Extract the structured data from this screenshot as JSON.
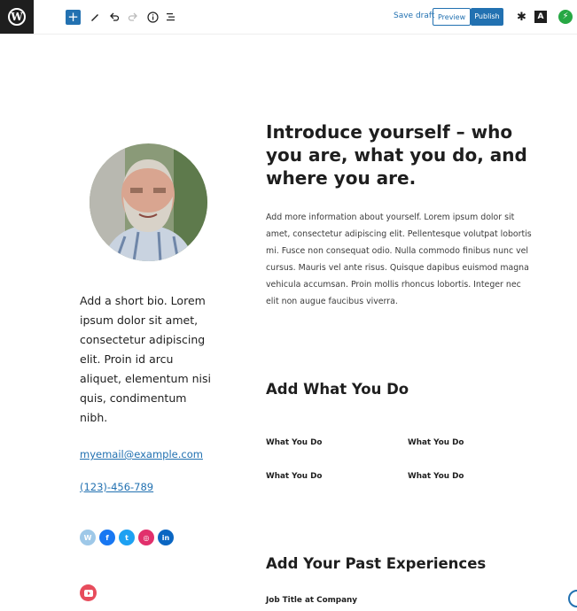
{
  "toolbar": {
    "save_draft": "Save draft",
    "preview": "Preview",
    "publish": "Publish",
    "add_icon": "plus-icon",
    "a_label": "A",
    "wp_logo_text": "W"
  },
  "profile": {
    "bio": "Add a short bio. Lorem ipsum dolor sit amet, consectetur adipiscing elit. Proin id arcu aliquet, elementum nisi quis, condimentum nibh.",
    "email": "myemail@example.com",
    "phone": "(123)-456-789",
    "socials": [
      {
        "name": "wordpress-icon",
        "color": "#9ec8e8",
        "glyph": "W"
      },
      {
        "name": "facebook-icon",
        "color": "#1877f2",
        "glyph": "f"
      },
      {
        "name": "twitter-icon",
        "color": "#1da1f2",
        "glyph": "t"
      },
      {
        "name": "instagram-icon",
        "color": "#e1306c",
        "glyph": "◎"
      },
      {
        "name": "linkedin-icon",
        "color": "#0a66c2",
        "glyph": "in"
      },
      {
        "name": "youtube-icon",
        "color": "#e74c5c",
        "glyph": "▶"
      }
    ]
  },
  "main": {
    "heading": "Introduce yourself – who you are, what you do, and where you are.",
    "paragraph": "Add more information about yourself. Lorem ipsum dolor sit amet, consectetur adipiscing elit. Pellentesque volutpat lobortis mi. Fusce non consequat odio. Nulla commodo finibus nunc vel cursus. Mauris vel ante risus. Quisque dapibus euismod magna vehicula accumsan. Proin mollis rhoncus lobortis. Integer nec elit non augue faucibus viverra.",
    "what_heading": "Add What You Do",
    "what_items": [
      "What You Do",
      "What You Do",
      "What You Do",
      "What You Do"
    ],
    "past_heading": "Add Your Past Experiences",
    "job_title": "Job Title at Company"
  },
  "colors": {
    "accent": "#2271b1"
  }
}
